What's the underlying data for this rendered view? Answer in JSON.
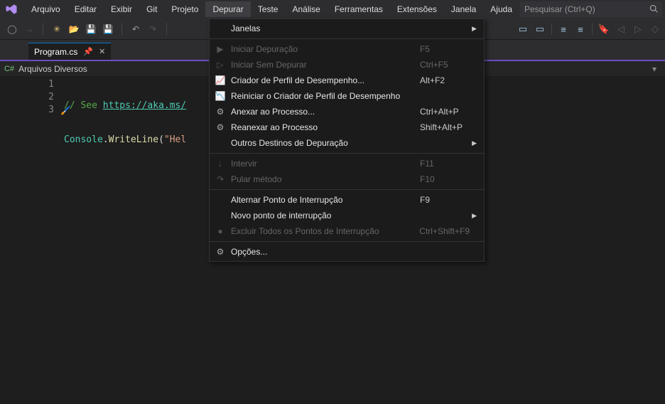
{
  "menubar": {
    "items": [
      "Arquivo",
      "Editar",
      "Exibir",
      "Git",
      "Projeto",
      "Depurar",
      "Teste",
      "Análise",
      "Ferramentas",
      "Extensões",
      "Janela",
      "Ajuda"
    ],
    "active_index": 5
  },
  "search": {
    "placeholder": "Pesquisar (Ctrl+Q)"
  },
  "doc_tab": {
    "title": "Program.cs"
  },
  "breadcrumb": {
    "label": "Arquivos Diversos"
  },
  "editor": {
    "lines": [
      "1",
      "2",
      "3"
    ],
    "line1_comment": "// See ",
    "line1_link": "https://aka.ms/",
    "line2_type": "Console",
    "line2_dot": ".",
    "line2_method": "WriteLine",
    "line2_open": "(",
    "line2_str": "\"Hel"
  },
  "dropdown": {
    "rows": [
      {
        "label": "Janelas",
        "shortcut": "",
        "icon": "",
        "submenu": true,
        "enabled": true
      },
      {
        "sep": true
      },
      {
        "label": "Iniciar Depuração",
        "shortcut": "F5",
        "icon": "play",
        "enabled": false
      },
      {
        "label": "Iniciar Sem Depurar",
        "shortcut": "Ctrl+F5",
        "icon": "play-outline",
        "enabled": false
      },
      {
        "label": "Criador de Perfil de Desempenho...",
        "shortcut": "Alt+F2",
        "icon": "perf",
        "enabled": true
      },
      {
        "label": "Reiniciar o Criador de Perfil de Desempenho",
        "shortcut": "",
        "icon": "perf-re",
        "enabled": true
      },
      {
        "label": "Anexar ao Processo...",
        "shortcut": "Ctrl+Alt+P",
        "icon": "attach",
        "enabled": true
      },
      {
        "label": "Reanexar ao Processo",
        "shortcut": "Shift+Alt+P",
        "icon": "attach-re",
        "enabled": true
      },
      {
        "label": "Outros Destinos de Depuração",
        "shortcut": "",
        "icon": "",
        "submenu": true,
        "enabled": true
      },
      {
        "sep": true
      },
      {
        "label": "Intervir",
        "shortcut": "F11",
        "icon": "step-in",
        "enabled": false
      },
      {
        "label": "Pular método",
        "shortcut": "F10",
        "icon": "step-over",
        "enabled": false
      },
      {
        "sep": true
      },
      {
        "label": "Alternar Ponto de Interrupção",
        "shortcut": "F9",
        "icon": "",
        "enabled": true
      },
      {
        "label": "Novo ponto de interrupção",
        "shortcut": "",
        "icon": "",
        "submenu": true,
        "enabled": true
      },
      {
        "label": "Excluir Todos os Pontos de Interrupção",
        "shortcut": "Ctrl+Shift+F9",
        "icon": "bp-del",
        "enabled": false
      },
      {
        "sep": true
      },
      {
        "label": "Opções...",
        "shortcut": "",
        "icon": "gear",
        "enabled": true
      }
    ]
  }
}
